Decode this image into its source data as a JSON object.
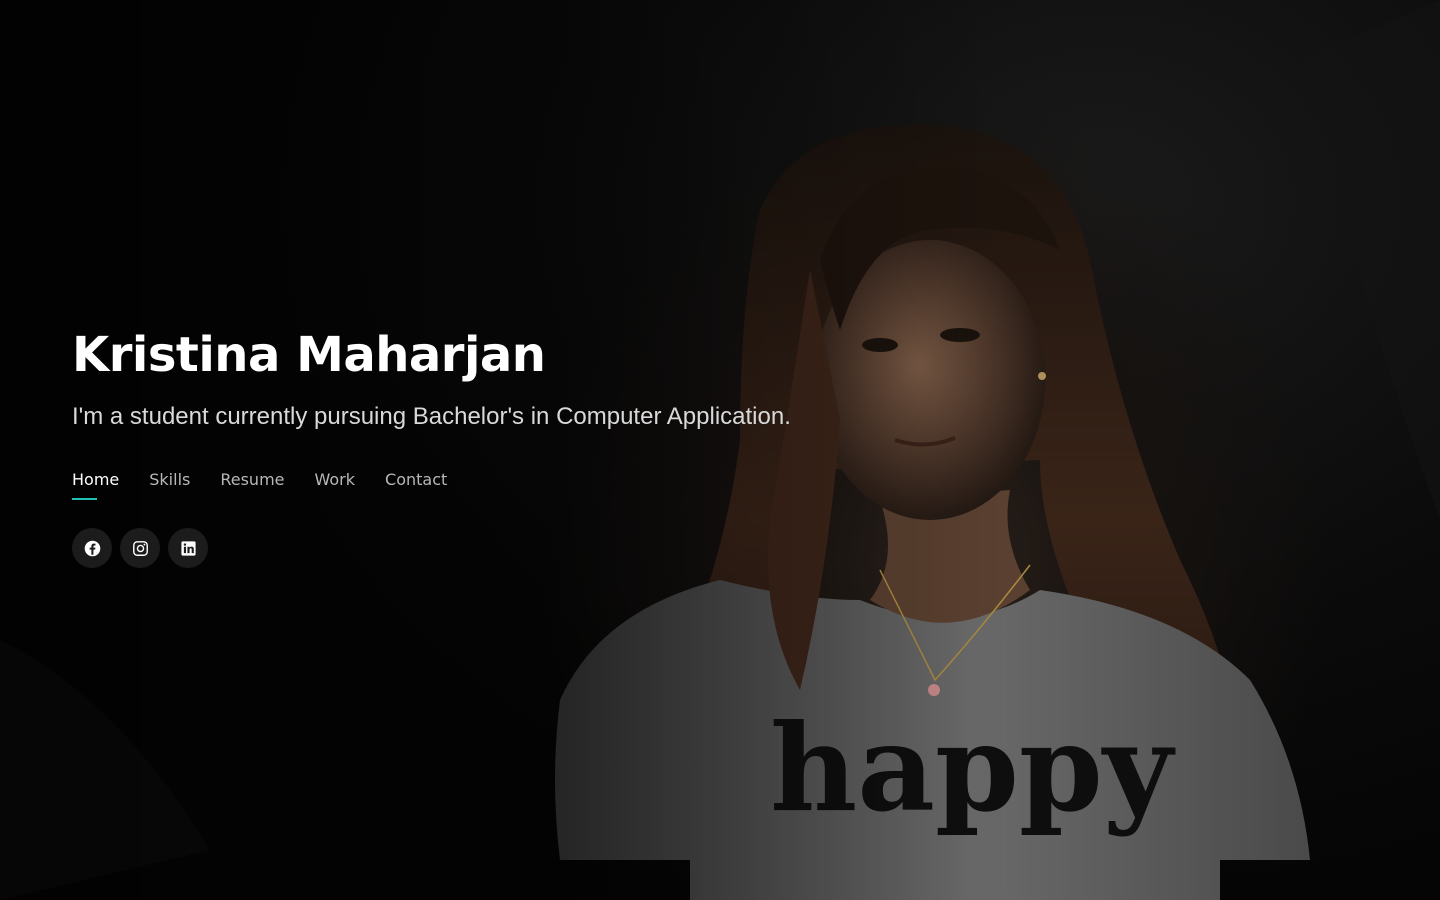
{
  "hero": {
    "name": "Kristina Maharjan",
    "tagline": "I'm a student currently pursuing Bachelor's in Computer Application."
  },
  "nav": {
    "items": [
      {
        "label": "Home",
        "active": true
      },
      {
        "label": "Skills",
        "active": false
      },
      {
        "label": "Resume",
        "active": false
      },
      {
        "label": "Work",
        "active": false
      },
      {
        "label": "Contact",
        "active": false
      }
    ]
  },
  "social": {
    "icons": [
      "facebook-icon",
      "instagram-icon",
      "linkedin-icon"
    ]
  },
  "background": {
    "shirt_text": "happy"
  },
  "colors": {
    "accent": "#1fc3b3",
    "text_primary": "#ffffff",
    "text_secondary": "#d9d9d9",
    "nav_inactive": "#b8b8b8",
    "background": "#080808"
  }
}
